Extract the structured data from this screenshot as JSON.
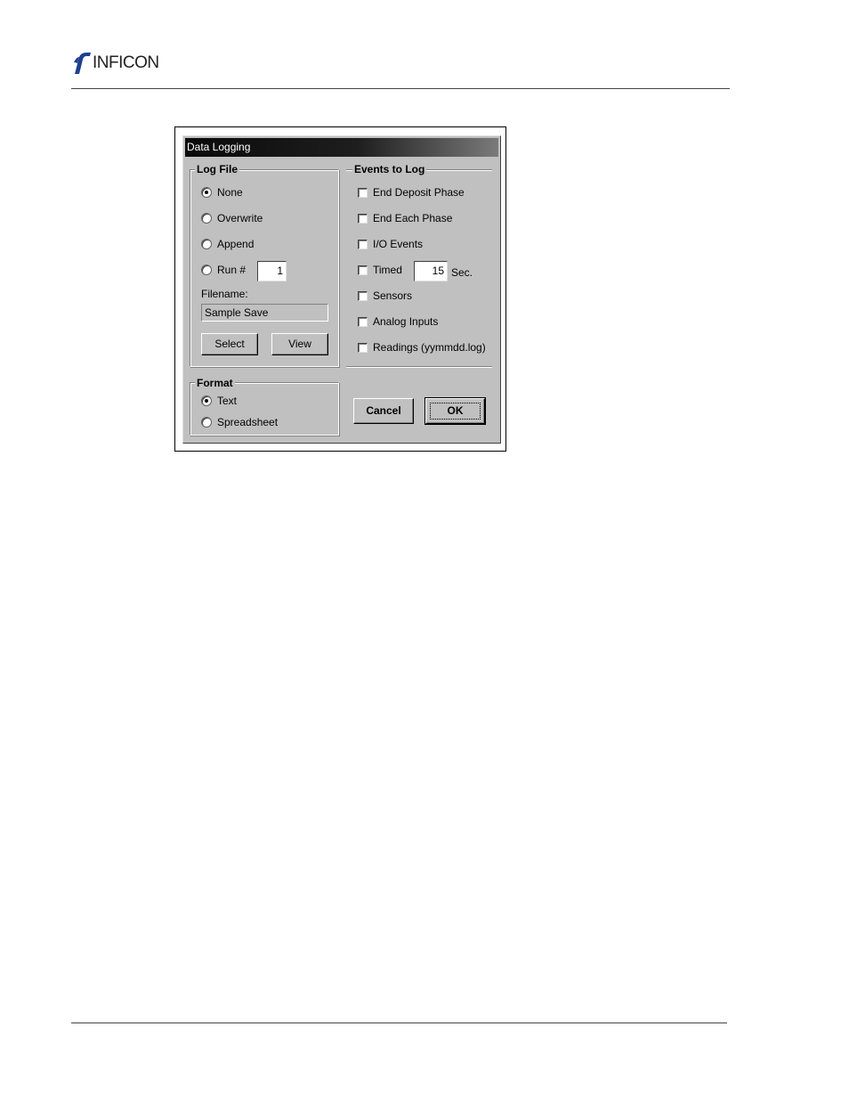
{
  "header": {
    "logo_text": "INFICON"
  },
  "dialog": {
    "title": "Data Logging",
    "log_file": {
      "legend": "Log File",
      "options": [
        {
          "label": "None",
          "selected": true
        },
        {
          "label": "Overwrite",
          "selected": false
        },
        {
          "label": "Append",
          "selected": false
        },
        {
          "label": "Run #",
          "selected": false
        }
      ],
      "run_number": "1",
      "filename_label": "Filename:",
      "filename_value": "Sample Save",
      "select_label": "Select",
      "view_label": "View"
    },
    "events": {
      "legend": "Events to Log",
      "items": [
        {
          "label": "End Deposit Phase",
          "checked": false
        },
        {
          "label": "End Each Phase",
          "checked": false
        },
        {
          "label": "I/O Events",
          "checked": false
        },
        {
          "label": "Timed",
          "checked": false
        },
        {
          "label": "Sensors",
          "checked": false
        },
        {
          "label": "Analog Inputs",
          "checked": false
        },
        {
          "label": "Readings (yymmdd.log)",
          "checked": false
        }
      ],
      "timed_value": "15",
      "timed_unit": "Sec."
    },
    "format": {
      "legend": "Format",
      "options": [
        {
          "label": "Text",
          "selected": true
        },
        {
          "label": "Spreadsheet",
          "selected": false
        }
      ]
    },
    "cancel_label": "Cancel",
    "ok_label": "OK"
  },
  "colors": {
    "dialog_bg": "#c0c0c0",
    "logo_blue": "#1f3f8f"
  }
}
